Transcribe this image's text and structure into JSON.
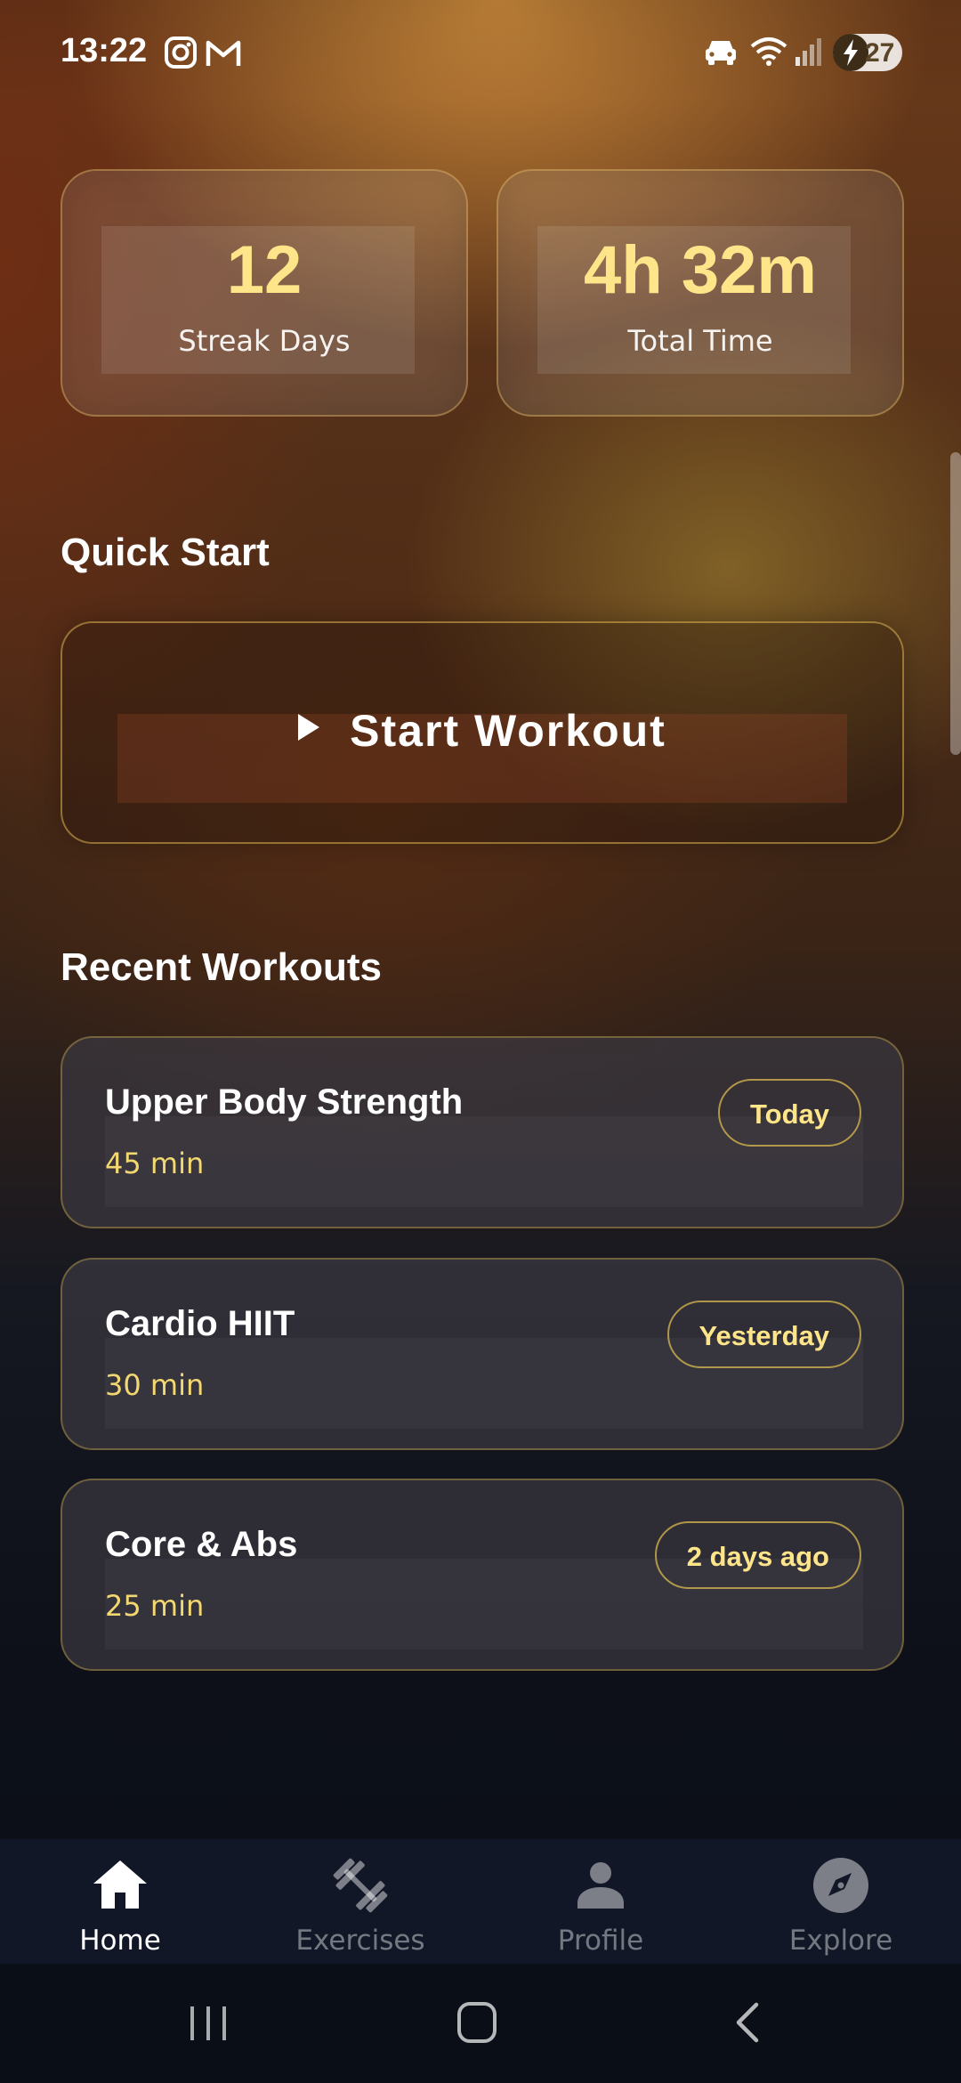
{
  "status_bar": {
    "time": "13:22",
    "battery": "27",
    "icons": [
      "instagram-icon",
      "gmail-icon",
      "car-icon",
      "wifi-icon",
      "signal-icon",
      "battery-charging-icon"
    ]
  },
  "stats": [
    {
      "value": "12",
      "label": "Streak Days"
    },
    {
      "value": "4h 32m",
      "label": "Total Time"
    }
  ],
  "quick_start": {
    "title": "Quick Start",
    "button_label": "Start Workout",
    "icon": "play-icon"
  },
  "recent": {
    "title": "Recent Workouts",
    "items": [
      {
        "name": "Upper Body Strength",
        "duration": "45 min",
        "when": "Today"
      },
      {
        "name": "Cardio HIIT",
        "duration": "30 min",
        "when": "Yesterday"
      },
      {
        "name": "Core & Abs",
        "duration": "25 min",
        "when": "2 days ago"
      }
    ]
  },
  "nav": {
    "active": "Home",
    "items": [
      {
        "label": "Home",
        "icon": "home-icon"
      },
      {
        "label": "Exercises",
        "icon": "dumbbell-icon"
      },
      {
        "label": "Profile",
        "icon": "person-icon"
      },
      {
        "label": "Explore",
        "icon": "compass-icon"
      }
    ]
  },
  "colors": {
    "accent": "#ffe58a",
    "duration": "#f3d770",
    "nav_bg": "#111726"
  }
}
